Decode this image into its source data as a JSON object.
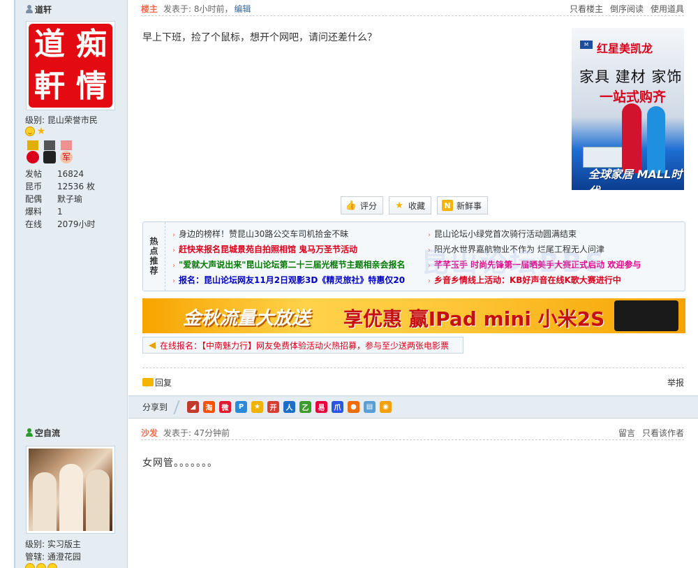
{
  "posts": [
    {
      "author": {
        "name": "道轩",
        "avatar_chars": [
          "道",
          "痴",
          "軒",
          "情"
        ],
        "level_label": "级别:",
        "level": "昆山荣誉市民",
        "stats": [
          {
            "label": "发帖",
            "value": "16824"
          },
          {
            "label": "昆币",
            "value": "12536 枚"
          },
          {
            "label": "配偶",
            "value": "默子瑜"
          },
          {
            "label": "爆料",
            "value": "1"
          },
          {
            "label": "在线",
            "value": "2079小时"
          }
        ],
        "medal_text": "军"
      },
      "meta": {
        "floor": "楼主",
        "posted": "发表于: 8小时前，",
        "edit": "编辑",
        "right_links": [
          "只看楼主",
          "倒序阅读",
          "使用道具"
        ]
      },
      "text": "早上下班，捡了个鼠标，想开个网吧，请问还差什么？",
      "ad_tower": {
        "logo": "M",
        "brand": "红星美凯龙",
        "line1": "家具 建材 家饰",
        "line2": "一站式购齐",
        "slogan": "全球家居 MALL时代"
      },
      "actions": [
        {
          "label": "评分",
          "icon": "thumbs-up-icon",
          "glyph": "👍"
        },
        {
          "label": "收藏",
          "icon": "star-icon",
          "glyph": "★"
        },
        {
          "label": "新鲜事",
          "icon": "news-icon",
          "glyph": "N"
        }
      ],
      "hot": {
        "label": "热点推荐",
        "left": [
          {
            "text": "身边的榜样！赞昆山30路公交车司机拾金不昧",
            "style": "c-dark"
          },
          {
            "text": "赶快来报名昆城景苑自拍照相馆 鬼马万圣节活动",
            "style": "c-red"
          },
          {
            "text": "\"爱就大声说出来\"昆山论坛第二十三届光棍节主题相亲会报名",
            "style": "c-green"
          },
          {
            "text": "报名：昆山论坛网友11月2日观影3D《精灵旅社》特惠仅20",
            "style": "c-blue"
          }
        ],
        "right": [
          {
            "text": "昆山论坛小绿党首次骑行活动圆满结束",
            "style": "c-dark"
          },
          {
            "text": "阳光水世界嘉航物业不作为 烂尾工程无人问津",
            "style": "c-dark"
          },
          {
            "text": "芊芊玉手 时尚先锋第一届晒美手大赛正式启动 欢迎参与",
            "style": "c-pink"
          },
          {
            "text": "乡音乡情线上活动：KB好声音在线K歌大赛进行中",
            "style": "c-red"
          }
        ]
      },
      "banner": {
        "left": "金秋流量大放送",
        "right": "享优惠 赢IPad mini 小米2S"
      },
      "notice": "在线报名：【中南魅力行】网友免费体验活动火热招募，参与至少送两张电影票",
      "reply": "回复",
      "report": "举报",
      "share_label": "分享到",
      "share_icons": [
        {
          "name": "share-icon-1",
          "color": "#c0392b",
          "glyph": "◢"
        },
        {
          "name": "share-icon-taobao",
          "color": "#ff5000",
          "glyph": "淘"
        },
        {
          "name": "share-icon-weibo",
          "color": "#e6162d",
          "glyph": "微"
        },
        {
          "name": "share-icon-qzone",
          "color": "#2a8ad8",
          "glyph": "P"
        },
        {
          "name": "share-icon-star",
          "color": "#f1b300",
          "glyph": "★"
        },
        {
          "name": "share-icon-kaixin",
          "color": "#d4402f",
          "glyph": "开"
        },
        {
          "name": "share-icon-renren",
          "color": "#1c6fc8",
          "glyph": "人"
        },
        {
          "name": "share-icon-green",
          "color": "#3c9a2f",
          "glyph": "乙"
        },
        {
          "name": "share-icon-sohu",
          "color": "#e8003a",
          "glyph": "易"
        },
        {
          "name": "share-icon-baidu",
          "color": "#2a55e4",
          "glyph": "爪"
        },
        {
          "name": "share-icon-apple",
          "color": "#f06d0a",
          "glyph": "●"
        },
        {
          "name": "share-icon-doc",
          "color": "#5a9ed6",
          "glyph": "▤"
        },
        {
          "name": "share-icon-chat",
          "color": "#f3a00a",
          "glyph": "◉"
        }
      ]
    },
    {
      "author": {
        "name": "空自流",
        "level_label": "级别:",
        "level": "实习版主",
        "manage_label": "管辖:",
        "manage": "通澄花园"
      },
      "meta": {
        "floor": "沙发",
        "posted": "发表于: 47分钟前",
        "right_links": [
          "留言",
          "只看该作者"
        ]
      },
      "text": "女网管。。。。。。。"
    }
  ],
  "watermark": "昆山论坛BBS"
}
